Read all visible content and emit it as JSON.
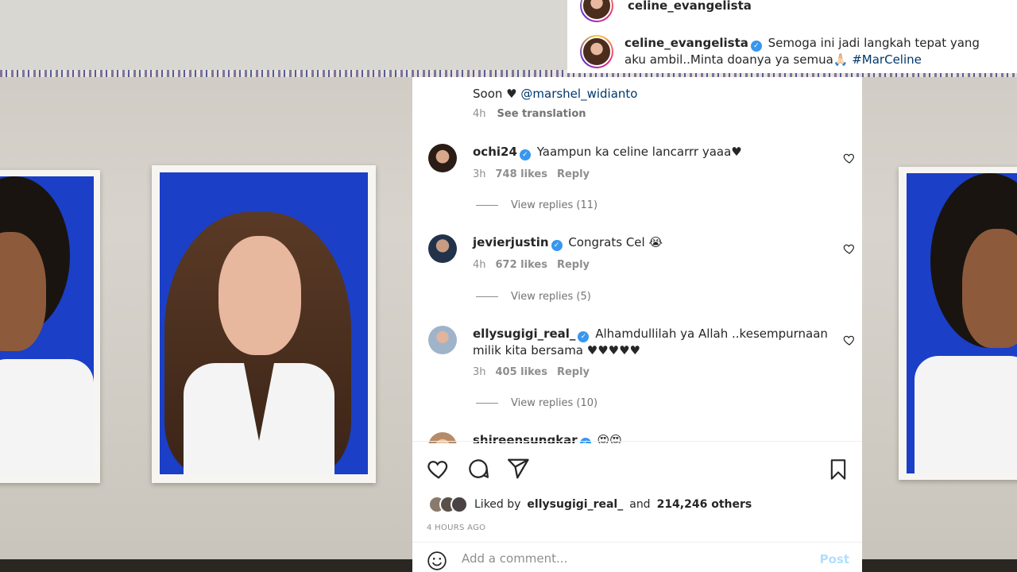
{
  "header": {
    "top_username": "celine_evangelista",
    "username": "celine_evangelista",
    "caption": "Semoga ini jadi langkah tepat yang aku ambil..Minta doanya ya semua🙏🏻",
    "hashtag": "#MarCeline"
  },
  "caption_tail": {
    "text": "Soon ♥",
    "mention": "@marshel_widianto",
    "time": "4h",
    "see_translation": "See translation"
  },
  "comments": [
    {
      "username": "ochi24",
      "text": "Yaampun ka celine lancarrr yaaa♥",
      "time": "3h",
      "likes": "748 likes",
      "reply": "Reply",
      "view_replies": "View replies (11)"
    },
    {
      "username": "jevierjustin",
      "text": "Congrats Cel 😭",
      "time": "4h",
      "likes": "672 likes",
      "reply": "Reply",
      "view_replies": "View replies (5)"
    },
    {
      "username": "ellysugigi_real_",
      "text": "Alhamdullilah ya Allah ..kesempurnaan milik kita bersama ♥♥♥♥♥",
      "time": "3h",
      "likes": "405 likes",
      "reply": "Reply",
      "view_replies": "View replies (10)"
    },
    {
      "username": "shireensungkar",
      "text": "😍😍"
    }
  ],
  "likes": {
    "prefix": "Liked by",
    "user": "ellysugigi_real_",
    "conj": "and",
    "count": "214,246 others"
  },
  "timestamp": "4 HOURS AGO",
  "add_comment": {
    "placeholder": "Add a comment...",
    "post_label": "Post"
  },
  "colors": {
    "link": "#00376b",
    "verified": "#3897f0",
    "post_disabled": "#b2dffc",
    "photo_blue": "#1b3fc7"
  },
  "icons": [
    "heart-icon",
    "comment-icon",
    "share-icon",
    "bookmark-icon",
    "emoji-icon",
    "verified-badge-icon"
  ]
}
